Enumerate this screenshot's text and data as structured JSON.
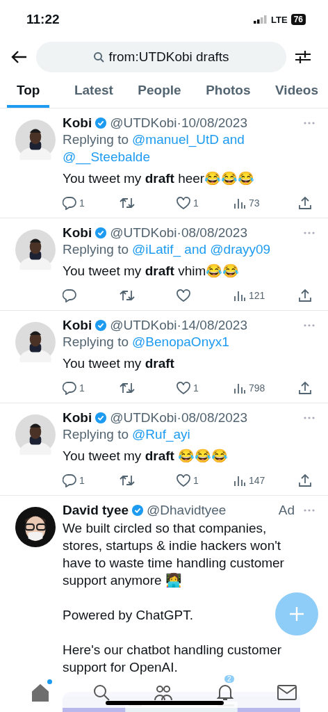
{
  "status_bar": {
    "time": "11:22",
    "network": "LTE",
    "battery": "76"
  },
  "search": {
    "value": "from:UTDKobi drafts"
  },
  "tabs": [
    {
      "label": "Top",
      "selected": true
    },
    {
      "label": "Latest",
      "selected": false
    },
    {
      "label": "People",
      "selected": false
    },
    {
      "label": "Photos",
      "selected": false
    },
    {
      "label": "Videos",
      "selected": false
    }
  ],
  "tweets": [
    {
      "name": "Kobi",
      "verified": true,
      "handle_date": "@UTDKobi·10/08/2023",
      "replying_to": "Replying to",
      "mentions": [
        "@manuel_UtD and",
        "@__Steebalde"
      ],
      "text": "You tweet my **draft** heer😂😂😂",
      "replies": "1",
      "likes": "1",
      "views": "73"
    },
    {
      "name": "Kobi",
      "verified": true,
      "handle_date": "@UTDKobi·08/08/2023",
      "replying_to": "Replying to",
      "mentions": [
        "@iLatif_ and @drayy09"
      ],
      "text": "You tweet my **draft** vhim😂😂",
      "views": "121"
    },
    {
      "name": "Kobi",
      "verified": true,
      "handle_date": "@UTDKobi·14/08/2023",
      "replying_to": "Replying to",
      "mentions": [
        "@BenopaOnyx1"
      ],
      "text": "You tweet my **draft**",
      "replies": "1",
      "likes": "1",
      "views": "798"
    },
    {
      "name": "Kobi",
      "verified": true,
      "handle_date": "@UTDKobi·08/08/2023",
      "replying_to": "Replying to",
      "mentions": [
        "@Ruf_ayi"
      ],
      "text": "You tweet my **draft** 😂😂😂",
      "replies": "1",
      "likes": "1",
      "views": "147"
    }
  ],
  "ad": {
    "name": "David tyee",
    "verified": true,
    "handle": "@Dhavidtyee",
    "badge": "Ad",
    "paragraphs": [
      "We built circled so that companies, stores, startups & indie hackers won't have to waste time handling customer support anymore 👩‍💻",
      "Powered by ChatGPT.",
      "Here's our chatbot handling customer support for OpenAI."
    ],
    "media": {
      "kind": "picture"
    }
  },
  "nav": [
    {
      "kind": "home",
      "selected": true,
      "dot": true
    },
    {
      "kind": "search",
      "selected": false
    },
    {
      "kind": "communities",
      "selected": false
    },
    {
      "kind": "notifications",
      "selected": false,
      "badge": "2"
    },
    {
      "kind": "messages",
      "selected": false
    }
  ]
}
